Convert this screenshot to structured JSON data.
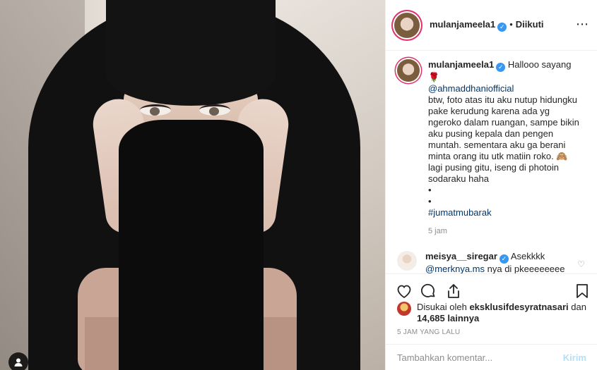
{
  "post": {
    "author": {
      "username": "mulanjameela1",
      "verified_mark": "✓",
      "separator": "•",
      "follow_status": "Diikuti"
    },
    "more_icon": "⋯",
    "tag_icon": "person-tag-icon",
    "caption": {
      "username": "mulanjameela1",
      "greeting": "Hallooo sayang 🌹",
      "mention": "@ahmaddhaniofficial",
      "text": "btw, foto atas itu aku nutup hidungku pake kerudung karena ada yg ngeroko dalam ruangan, sampe bikin aku pusing kepala dan pengen muntah. sementara aku ga berani minta orang itu utk matiin roko. 🙈 lagi pusing gitu, iseng di photoin sodaraku haha",
      "bullet1": "•",
      "bullet2": "•",
      "hashtag": "#jumatmubarak",
      "time": "5 jam"
    },
    "comment": {
      "username": "meisya__siregar",
      "text": "Asekkkk",
      "mention": "@merknya.ms",
      "text2": "nya di pkeeeeeeee",
      "hearts": "♥♥♥♥"
    },
    "likes": {
      "prefix": "Disukai oleh",
      "user": "eksklusifdesyratnasari",
      "connector": "dan",
      "count": "14,685 lainnya"
    },
    "posted_ago": "5 JAM YANG LALU",
    "add_comment": {
      "placeholder": "Tambahkan komentar...",
      "submit": "Kirim"
    },
    "colors": {
      "accent": "#3897f0",
      "link": "#00376b",
      "heart": "#ed4956",
      "post_btn_disabled": "#b2dffc",
      "muted": "#8e8e8e"
    }
  }
}
